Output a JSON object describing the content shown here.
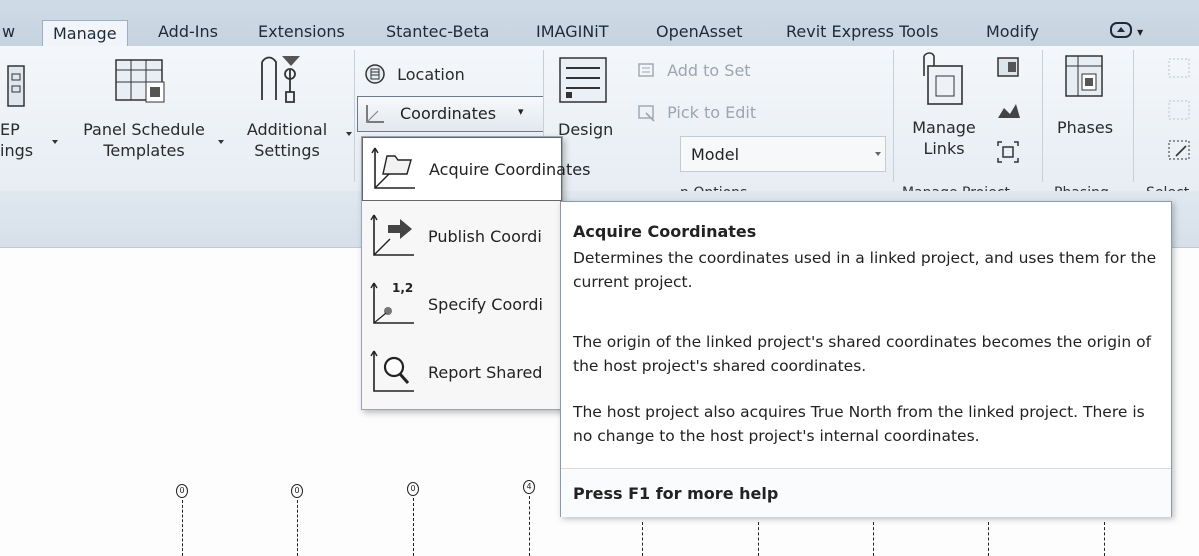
{
  "tabs": {
    "partial_left": "w",
    "manage": "Manage",
    "addins": "Add-Ins",
    "extensions": "Extensions",
    "stantec": "Stantec-Beta",
    "imaginit": "IMAGINiT",
    "openasset": "OpenAsset",
    "revit_express": "Revit Express Tools",
    "modify": "Modify",
    "qat_arrow": "▾"
  },
  "ribbon": {
    "mep_settings_line1": "EP",
    "mep_settings_line2": "ings",
    "panel_schedule_line1": "Panel Schedule",
    "panel_schedule_line2": "Templates",
    "additional_line1": "Additional",
    "additional_line2": "Settings",
    "location": "Location",
    "coordinates": "Coordinates",
    "coordinates_arrow": "▾",
    "design_partial": "Design",
    "add_to_set": "Add to Set",
    "pick_to_edit": "Pick to Edit",
    "model_dropdown": "Model",
    "options_partial": "n Options",
    "manage_links_line1": "Manage",
    "manage_links_line2": "Links",
    "phases": "Phases",
    "manage_project_partial": "Manage Project",
    "phasing_partial": "Phasing",
    "select_partial": "Select"
  },
  "menu": {
    "items": [
      {
        "label": "Acquire Coordinates"
      },
      {
        "label": "Publish Coordi"
      },
      {
        "label": "Specify Coordi"
      },
      {
        "label": "Report Shared"
      }
    ],
    "specify_icon_text": "1,2"
  },
  "tooltip": {
    "title": "Acquire Coordinates",
    "para1": "Determines the coordinates used in a linked project, and uses them for the current project.",
    "para2": "The origin of the linked project's shared coordinates becomes the origin of the host project's shared coordinates.",
    "para3": "The host project also acquires True North from the linked project. There is no change to the host project's internal coordinates.",
    "footer": "Press F1 for more help"
  },
  "grid": {
    "labels": [
      "0",
      "0",
      "0",
      "4"
    ]
  },
  "colors": {
    "tabbar": "#c9d6e2",
    "ribbon": "#eef2f6",
    "tooltip_border": "#8c99a6"
  }
}
